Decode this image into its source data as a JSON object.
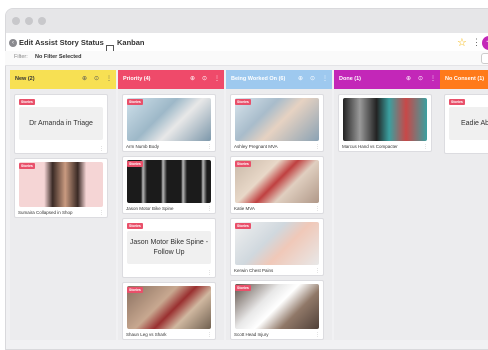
{
  "header": {
    "title": "Edit Assist Story Status",
    "tab_label": "Kanban"
  },
  "filter": {
    "label": "Filter:",
    "value": "No Filter Selected"
  },
  "colors": {
    "accent": "#b0299c",
    "badge": "#e9506a",
    "star": "#f5b400"
  },
  "columns": [
    {
      "name": "New (2)",
      "color": "#f7e053",
      "cards": [
        {
          "badge": "Stories",
          "text": "Dr Amanda in Triage",
          "caption": ""
        },
        {
          "badge": "Stories",
          "caption": "Sumaira Collapsed in Shop"
        }
      ]
    },
    {
      "name": "Priority (4)",
      "color": "#ef4a6a",
      "cards": [
        {
          "badge": "Stories",
          "caption": "Arm Numb Body"
        },
        {
          "badge": "Stories",
          "caption": "Jason Motor Bike Spine"
        },
        {
          "badge": "Stories",
          "text": "Jason Motor Bike Spine - Follow Up",
          "caption": ""
        },
        {
          "badge": "Stories",
          "caption": "Shaun Leg vs Shark"
        }
      ]
    },
    {
      "name": "Being Worked On (6)",
      "color": "#9ec9ef",
      "cards": [
        {
          "badge": "Stories",
          "caption": "Ashley Pregnant MVA"
        },
        {
          "badge": "Stories",
          "caption": "Katie MVA"
        },
        {
          "badge": "Stories",
          "caption": "Kerwin Chest Pains"
        },
        {
          "badge": "Stories",
          "caption": "Scott Head Injury"
        }
      ]
    },
    {
      "name": "Done (1)",
      "color": "#c327b8",
      "cards": [
        {
          "badge": "Stories",
          "caption": "Marcus Hand vs Compacter"
        }
      ]
    },
    {
      "name": "No Consent (1)",
      "color": "#ff7a1a",
      "cards": [
        {
          "badge": "Stories",
          "text": "Eadie Abdo",
          "caption": ""
        }
      ]
    }
  ]
}
